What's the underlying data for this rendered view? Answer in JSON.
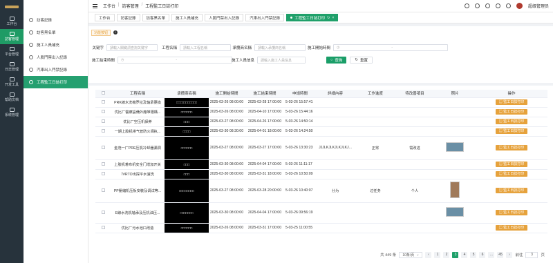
{
  "rail": [
    {
      "label": "工作台",
      "icon": "monitor-icon",
      "active": false
    },
    {
      "label": "訪客管理",
      "icon": "user-icon",
      "active": true
    },
    {
      "label": "平台管理",
      "icon": "grid-icon",
      "active": false
    },
    {
      "label": "日志管理",
      "icon": "log-icon",
      "active": false
    },
    {
      "label": "开发工具",
      "icon": "tool-icon",
      "active": false
    },
    {
      "label": "帮助文档",
      "icon": "help-icon",
      "active": false
    },
    {
      "label": "系统管理",
      "icon": "settings-icon",
      "active": false
    }
  ],
  "submenu": [
    {
      "label": "訪客記錄",
      "icon": "pin-icon",
      "active": false
    },
    {
      "label": "訪客黑名單",
      "icon": "user-icon",
      "active": false
    },
    {
      "label": "施工人員補充",
      "icon": "user-icon",
      "active": false
    },
    {
      "label": "人臉門禁出入記錄",
      "icon": "user-icon",
      "active": false
    },
    {
      "label": "汽車出入門禁記錄",
      "icon": "car-icon",
      "active": false
    },
    {
      "label": "工程監工日誌打印",
      "icon": "print-icon",
      "active": true
    }
  ],
  "header": {
    "crumb1": "工作台",
    "crumb2": "訪客管理",
    "crumb3": "工程監工日誌打印",
    "user": "超级管理员"
  },
  "tabs": [
    "工作台",
    "訪客記錄",
    "訪客黑名單",
    "施工人員補充",
    "人臉門禁出入記錄",
    "汽車出入門禁記錄",
    "工程監工日誌打印"
  ],
  "filter": {
    "button": "功能按钮",
    "kw_label": "关键字",
    "kw_ph": "請輸入關鍵詞查詢关键字",
    "proj_label": "工程名稱",
    "proj_ph": "請輸入工程名稱",
    "vendor_label": "承攬商名稱",
    "vendor_ph": "請輸入承攬商名稱",
    "start_label": "施工開始時間",
    "start_sep": "-",
    "end_label": "施工結束時間",
    "end_sep": "-",
    "worker_label": "施工人員信息",
    "worker_ph": "請輸入施工人員信息",
    "search": "查詢",
    "reset": "重置"
  },
  "table": {
    "headers": [
      "",
      "工程名稱",
      "承攬商名稱",
      "施工開始時間",
      "施工結束時間",
      "申請時間",
      "詳細內容",
      "工作進度",
      "待改善項目",
      "照片",
      "操作"
    ],
    "action_label": "監工日誌打印",
    "rows": [
      {
        "name": "PRK線水洗機罗拉及轴承更換",
        "vendor": "□□□□□□□□□□□",
        "start": "2025-03-26 08:00:00",
        "end": "2025-03-28 17:00:00",
        "apply": "5-03-26 15:57:41",
        "detail": "",
        "progress": "",
        "improve": "",
        "photo": false
      },
      {
        "name": "优比厂醫療設備外廠堆隱構...",
        "vendor": "□□□□□□",
        "start": "2025-03-26 08:00:00",
        "end": "2025-04-10 17:00:00",
        "apply": "5-03-26 15:44:16",
        "detail": "",
        "progress": "",
        "improve": "",
        "photo": false
      },
      {
        "name": "优比厂空压机保养",
        "vendor": "□□□",
        "start": "2025-03-27 08:00:00",
        "end": "2025-04-26 17:00:00",
        "apply": "5-03-26 14:50:14",
        "detail": "",
        "progress": "",
        "improve": "",
        "photo": false
      },
      {
        "name": "一期上胶机排气管防火阀执...",
        "vendor": "□□□□",
        "start": "2025-03-30 08:30:00",
        "end": "2025-04-01 18:00:00",
        "apply": "5-03-26 14:24:50",
        "detail": "",
        "progress": "",
        "improve": "",
        "photo": false
      },
      {
        "name": "金茂一厂PRE压机冷却器漏洞",
        "vendor": "□□□□□□",
        "start": "2025-03-27 08:00:00",
        "end": "2025-03-27 17:00:00",
        "apply": "5-03-26 13:30:23",
        "detail": "JJJLKJLKJLKJLKJ...",
        "progress": "正常",
        "improve": "需改进",
        "photo": true
      },
      {
        "name": "上胶机着布机安全门增加开关",
        "vendor": "□□□",
        "start": "2025-03-30 08:00:00",
        "end": "2025-04-04 17:00:00",
        "apply": "5-03-26 11:11:17",
        "detail": "",
        "progress": "",
        "improve": "",
        "photo": false
      },
      {
        "name": "7#RTO出探平水濾洗",
        "vendor": "□□□",
        "start": "2025-03-30 08:00:00",
        "end": "2025-03-31 18:00:00",
        "apply": "5-03-26 10:50:09",
        "detail": "",
        "progress": "",
        "improve": "",
        "photo": false
      },
      {
        "name": "PP壓縮机压板安裝及调试等...",
        "vendor": "□□□□□□□□",
        "start": "2025-03-27 08:00:00",
        "end": "2025-03-28 20:00:00",
        "apply": "5-03-26 10:40:07",
        "detail": "分为",
        "progress": "过任务",
        "improve": "个人",
        "photo": true
      },
      {
        "name": "E線水洗机轴承及压机油压...",
        "vendor": "□□□□□□□",
        "start": "2025-03-30 08:00:00",
        "end": "2025-04-04 17:00:00",
        "apply": "5-03-26 09:56:19",
        "detail": "",
        "progress": "",
        "improve": "",
        "photo": true
      },
      {
        "name": "优比厂污水池口改造",
        "vendor": "□□□□□□",
        "start": "2025-03-26 08:00:00",
        "end": "2025-03-31 17:00:00",
        "apply": "5-03-25 11:00:55",
        "detail": "",
        "progress": "",
        "improve": "",
        "photo": false
      }
    ]
  },
  "pager": {
    "total": "共 449 条",
    "size": "10条/页",
    "pages": [
      "1",
      "2",
      "3",
      "4",
      "5",
      "6",
      "...",
      "45"
    ],
    "active": "3",
    "goto": "前往",
    "goto_val": "3",
    "unit": "页"
  }
}
